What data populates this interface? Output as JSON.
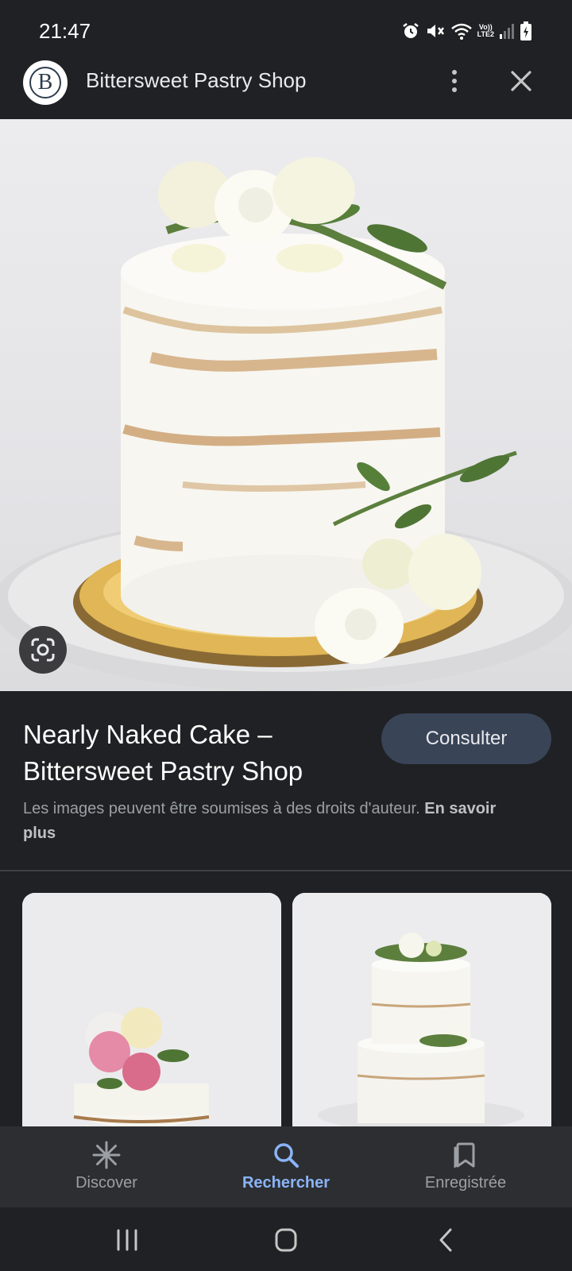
{
  "status_bar": {
    "time": "21:47",
    "icons": [
      "alarm-icon",
      "mute-icon",
      "wifi-icon",
      "lte-signal-icon",
      "battery-charging-icon"
    ],
    "network_label_top": "Vo))",
    "network_label_bottom": "LTE2"
  },
  "header": {
    "logo_letter": "B",
    "site_name": "Bittersweet Pastry Shop",
    "more_icon": "more-vert-icon",
    "close_icon": "close-icon"
  },
  "hero": {
    "lens_icon": "google-lens-icon"
  },
  "result": {
    "title": "Nearly Naked Cake – Bittersweet Pastry Shop",
    "visit_label": "Consulter",
    "copyright_text": "Les images peuvent être soumises à des droits d'auteur.",
    "learn_more": "En savoir plus"
  },
  "bottom_nav": {
    "items": [
      {
        "label": "Discover",
        "icon": "asterisk-icon"
      },
      {
        "label": "Rechercher",
        "icon": "search-icon",
        "active": true
      },
      {
        "label": "Enregistrée",
        "icon": "bookmarks-icon"
      }
    ]
  },
  "system_nav": {
    "items": [
      "recents-icon",
      "home-icon",
      "back-icon"
    ]
  },
  "colors": {
    "background": "#202124",
    "accent": "#8ab4f8",
    "visit_button": "#394457",
    "nav_bar": "#2d2e31"
  }
}
